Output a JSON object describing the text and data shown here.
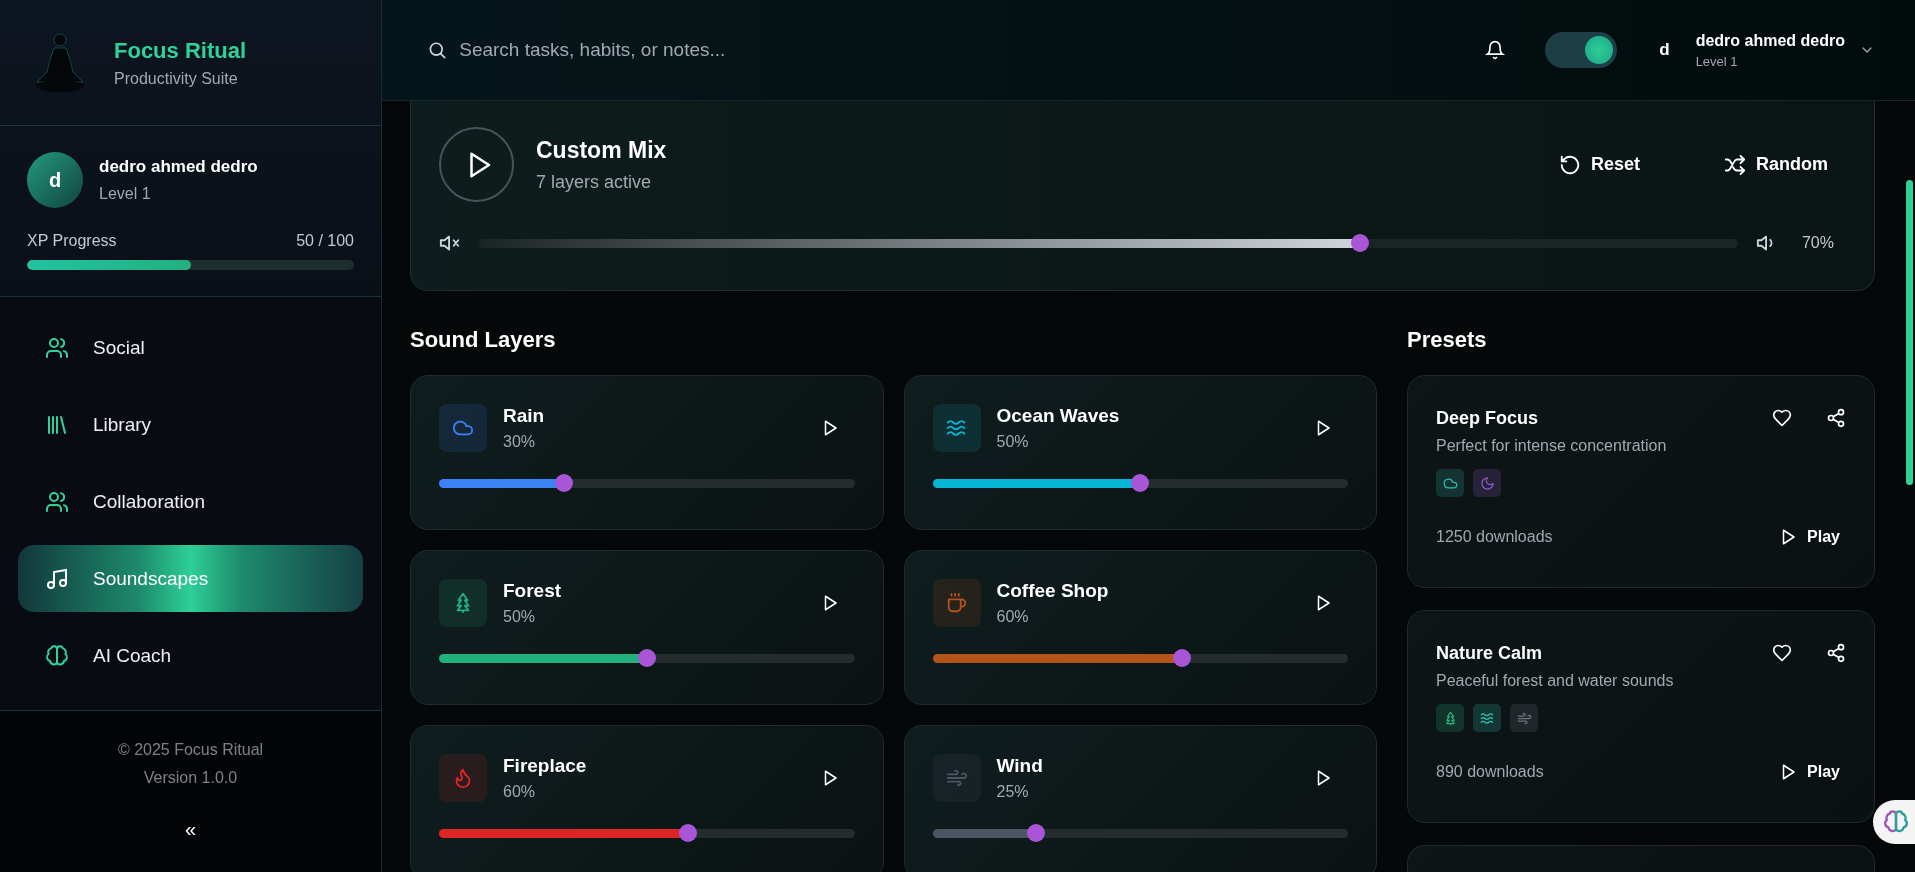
{
  "brand": {
    "title": "Focus Ritual",
    "subtitle": "Productivity Suite"
  },
  "user": {
    "initial": "d",
    "name": "dedro ahmed dedro",
    "level": "Level 1"
  },
  "xp": {
    "label": "XP Progress",
    "value": "50 / 100",
    "level": 0.5
  },
  "nav": [
    {
      "label": "Social",
      "selected": false
    },
    {
      "label": "Library",
      "selected": false
    },
    {
      "label": "Collaboration",
      "selected": false
    },
    {
      "label": "Soundscapes",
      "selected": true
    },
    {
      "label": "AI Coach",
      "selected": false
    }
  ],
  "footer": {
    "copyright": "© 2025 Focus Ritual",
    "version": "Version 1.0.0",
    "collapse": "«"
  },
  "header": {
    "search_placeholder": "Search tasks, habits, or notes...",
    "theme_toggle_on": true,
    "user_initial": "d",
    "user_name": "dedro ahmed dedro",
    "user_level": "Level 1"
  },
  "mix": {
    "title": "Custom Mix",
    "subtitle": "7 layers active",
    "reset": "Reset",
    "random": "Random",
    "level": 0.7,
    "reading": "70%"
  },
  "layers_title": "Sound Layers",
  "layers": [
    {
      "name": "Rain",
      "reading": "30%",
      "level": 0.3,
      "color": "#3b82f6"
    },
    {
      "name": "Ocean Waves",
      "reading": "50%",
      "level": 0.5,
      "color": "#06b6d4"
    },
    {
      "name": "Forest",
      "reading": "50%",
      "level": 0.5,
      "color": "#22b07d"
    },
    {
      "name": "Coffee Shop",
      "reading": "60%",
      "level": 0.6,
      "color": "#b4531a"
    },
    {
      "name": "Fireplace",
      "reading": "60%",
      "level": 0.6,
      "color": "#dc2626"
    },
    {
      "name": "Wind",
      "reading": "25%",
      "level": 0.25,
      "color": "#4b5563"
    }
  ],
  "presets_title": "Presets",
  "presets": [
    {
      "title": "Deep Focus",
      "description": "Perfect for intense concentration",
      "downloads": "1250 downloads",
      "play": "Play",
      "tags": [
        {
          "color": "#2fb5b0"
        },
        {
          "color": "#8b5cc6"
        }
      ]
    },
    {
      "title": "Nature Calm",
      "description": "Peaceful forest and water sounds",
      "downloads": "890 downloads",
      "play": "Play",
      "tags": [
        {
          "color": "#22b07d"
        },
        {
          "color": "#2fc2b8"
        },
        {
          "color": "#6b7280"
        }
      ]
    }
  ]
}
